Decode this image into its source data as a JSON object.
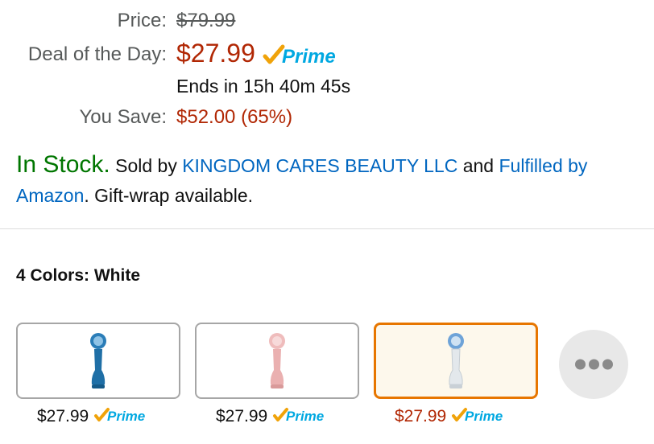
{
  "price": {
    "label": "Price:",
    "list_price": "$79.99"
  },
  "deal": {
    "label": "Deal of the Day:",
    "price": "$27.99",
    "prime_badge": "Prime",
    "ends": "Ends in 15h 40m 45s"
  },
  "savings": {
    "label": "You Save:",
    "value": "$52.00 (65%)"
  },
  "availability": {
    "status": "In Stock.",
    "sold_by_prefix": "Sold by",
    "seller": "KINGDOM CARES BEAUTY LLC",
    "and": "and",
    "fulfilled_by": "Fulfilled by Amazon",
    "gift_wrap": ". Gift-wrap available."
  },
  "colors": {
    "label": "4 Colors: White",
    "swatches": [
      {
        "name": "blue",
        "price": "$27.99",
        "prime": "Prime",
        "device_color": "#1f6fa6",
        "selected": false
      },
      {
        "name": "pink",
        "price": "$27.99",
        "prime": "Prime",
        "device_color": "#eab0b0",
        "selected": false
      },
      {
        "name": "white",
        "price": "$27.99",
        "prime": "Prime",
        "device_color": "#dfe6ea",
        "selected": true
      }
    ],
    "more_icon": "ellipsis-icon"
  },
  "colors_theme": {
    "deal_red": "#b12704",
    "stock_green": "#007600",
    "link_blue": "#0066c0",
    "prime_orange": "#f0a30a",
    "prime_blue": "#00a8e1",
    "selected_border": "#e77600"
  }
}
